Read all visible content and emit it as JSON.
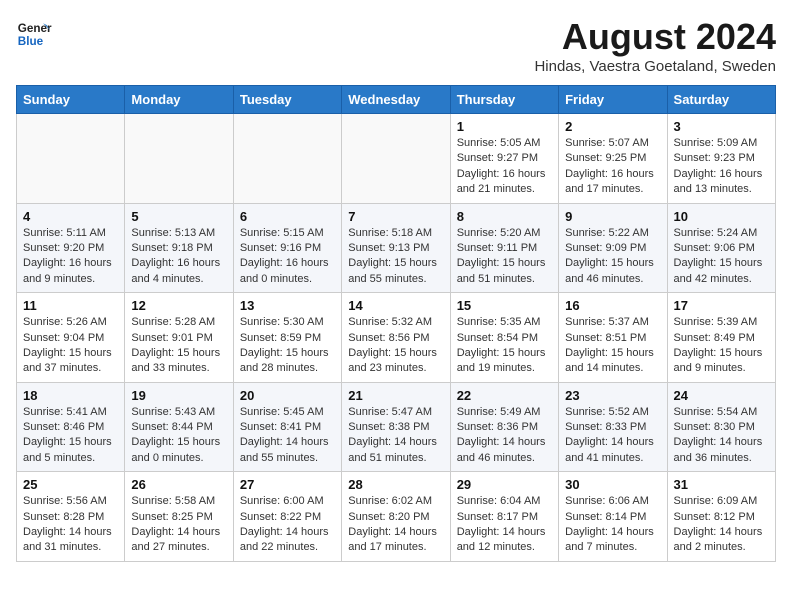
{
  "header": {
    "logo_line1": "General",
    "logo_line2": "Blue",
    "main_title": "August 2024",
    "sub_title": "Hindas, Vaestra Goetaland, Sweden"
  },
  "columns": [
    "Sunday",
    "Monday",
    "Tuesday",
    "Wednesday",
    "Thursday",
    "Friday",
    "Saturday"
  ],
  "weeks": [
    [
      {
        "day": "",
        "info": ""
      },
      {
        "day": "",
        "info": ""
      },
      {
        "day": "",
        "info": ""
      },
      {
        "day": "",
        "info": ""
      },
      {
        "day": "1",
        "info": "Sunrise: 5:05 AM\nSunset: 9:27 PM\nDaylight: 16 hours\nand 21 minutes."
      },
      {
        "day": "2",
        "info": "Sunrise: 5:07 AM\nSunset: 9:25 PM\nDaylight: 16 hours\nand 17 minutes."
      },
      {
        "day": "3",
        "info": "Sunrise: 5:09 AM\nSunset: 9:23 PM\nDaylight: 16 hours\nand 13 minutes."
      }
    ],
    [
      {
        "day": "4",
        "info": "Sunrise: 5:11 AM\nSunset: 9:20 PM\nDaylight: 16 hours\nand 9 minutes."
      },
      {
        "day": "5",
        "info": "Sunrise: 5:13 AM\nSunset: 9:18 PM\nDaylight: 16 hours\nand 4 minutes."
      },
      {
        "day": "6",
        "info": "Sunrise: 5:15 AM\nSunset: 9:16 PM\nDaylight: 16 hours\nand 0 minutes."
      },
      {
        "day": "7",
        "info": "Sunrise: 5:18 AM\nSunset: 9:13 PM\nDaylight: 15 hours\nand 55 minutes."
      },
      {
        "day": "8",
        "info": "Sunrise: 5:20 AM\nSunset: 9:11 PM\nDaylight: 15 hours\nand 51 minutes."
      },
      {
        "day": "9",
        "info": "Sunrise: 5:22 AM\nSunset: 9:09 PM\nDaylight: 15 hours\nand 46 minutes."
      },
      {
        "day": "10",
        "info": "Sunrise: 5:24 AM\nSunset: 9:06 PM\nDaylight: 15 hours\nand 42 minutes."
      }
    ],
    [
      {
        "day": "11",
        "info": "Sunrise: 5:26 AM\nSunset: 9:04 PM\nDaylight: 15 hours\nand 37 minutes."
      },
      {
        "day": "12",
        "info": "Sunrise: 5:28 AM\nSunset: 9:01 PM\nDaylight: 15 hours\nand 33 minutes."
      },
      {
        "day": "13",
        "info": "Sunrise: 5:30 AM\nSunset: 8:59 PM\nDaylight: 15 hours\nand 28 minutes."
      },
      {
        "day": "14",
        "info": "Sunrise: 5:32 AM\nSunset: 8:56 PM\nDaylight: 15 hours\nand 23 minutes."
      },
      {
        "day": "15",
        "info": "Sunrise: 5:35 AM\nSunset: 8:54 PM\nDaylight: 15 hours\nand 19 minutes."
      },
      {
        "day": "16",
        "info": "Sunrise: 5:37 AM\nSunset: 8:51 PM\nDaylight: 15 hours\nand 14 minutes."
      },
      {
        "day": "17",
        "info": "Sunrise: 5:39 AM\nSunset: 8:49 PM\nDaylight: 15 hours\nand 9 minutes."
      }
    ],
    [
      {
        "day": "18",
        "info": "Sunrise: 5:41 AM\nSunset: 8:46 PM\nDaylight: 15 hours\nand 5 minutes."
      },
      {
        "day": "19",
        "info": "Sunrise: 5:43 AM\nSunset: 8:44 PM\nDaylight: 15 hours\nand 0 minutes."
      },
      {
        "day": "20",
        "info": "Sunrise: 5:45 AM\nSunset: 8:41 PM\nDaylight: 14 hours\nand 55 minutes."
      },
      {
        "day": "21",
        "info": "Sunrise: 5:47 AM\nSunset: 8:38 PM\nDaylight: 14 hours\nand 51 minutes."
      },
      {
        "day": "22",
        "info": "Sunrise: 5:49 AM\nSunset: 8:36 PM\nDaylight: 14 hours\nand 46 minutes."
      },
      {
        "day": "23",
        "info": "Sunrise: 5:52 AM\nSunset: 8:33 PM\nDaylight: 14 hours\nand 41 minutes."
      },
      {
        "day": "24",
        "info": "Sunrise: 5:54 AM\nSunset: 8:30 PM\nDaylight: 14 hours\nand 36 minutes."
      }
    ],
    [
      {
        "day": "25",
        "info": "Sunrise: 5:56 AM\nSunset: 8:28 PM\nDaylight: 14 hours\nand 31 minutes."
      },
      {
        "day": "26",
        "info": "Sunrise: 5:58 AM\nSunset: 8:25 PM\nDaylight: 14 hours\nand 27 minutes."
      },
      {
        "day": "27",
        "info": "Sunrise: 6:00 AM\nSunset: 8:22 PM\nDaylight: 14 hours\nand 22 minutes."
      },
      {
        "day": "28",
        "info": "Sunrise: 6:02 AM\nSunset: 8:20 PM\nDaylight: 14 hours\nand 17 minutes."
      },
      {
        "day": "29",
        "info": "Sunrise: 6:04 AM\nSunset: 8:17 PM\nDaylight: 14 hours\nand 12 minutes."
      },
      {
        "day": "30",
        "info": "Sunrise: 6:06 AM\nSunset: 8:14 PM\nDaylight: 14 hours\nand 7 minutes."
      },
      {
        "day": "31",
        "info": "Sunrise: 6:09 AM\nSunset: 8:12 PM\nDaylight: 14 hours\nand 2 minutes."
      }
    ]
  ]
}
